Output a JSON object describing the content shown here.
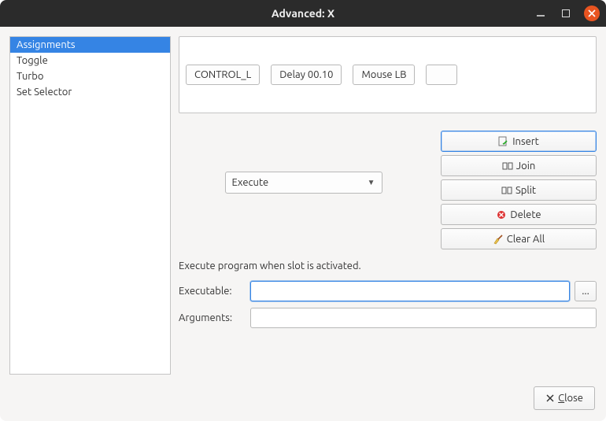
{
  "window": {
    "title": "Advanced: X"
  },
  "sidebar": {
    "items": [
      {
        "label": "Assignments",
        "selected": true
      },
      {
        "label": "Toggle",
        "selected": false
      },
      {
        "label": "Turbo",
        "selected": false
      },
      {
        "label": "Set Selector",
        "selected": false
      }
    ]
  },
  "slots": [
    {
      "label": "CONTROL_L"
    },
    {
      "label": "Delay 00.10"
    },
    {
      "label": "Mouse LB"
    },
    {
      "label": ""
    }
  ],
  "action_dropdown": {
    "selected": "Execute"
  },
  "buttons": {
    "insert": "Insert",
    "join": "Join",
    "split": "Split",
    "delete": "Delete",
    "clear_all": "Clear All"
  },
  "description": "Execute program when slot is activated.",
  "form": {
    "executable_label": "Executable:",
    "executable_value": "",
    "arguments_label": "Arguments:",
    "arguments_value": "",
    "browse_label": "..."
  },
  "footer": {
    "close_label": "Close"
  }
}
